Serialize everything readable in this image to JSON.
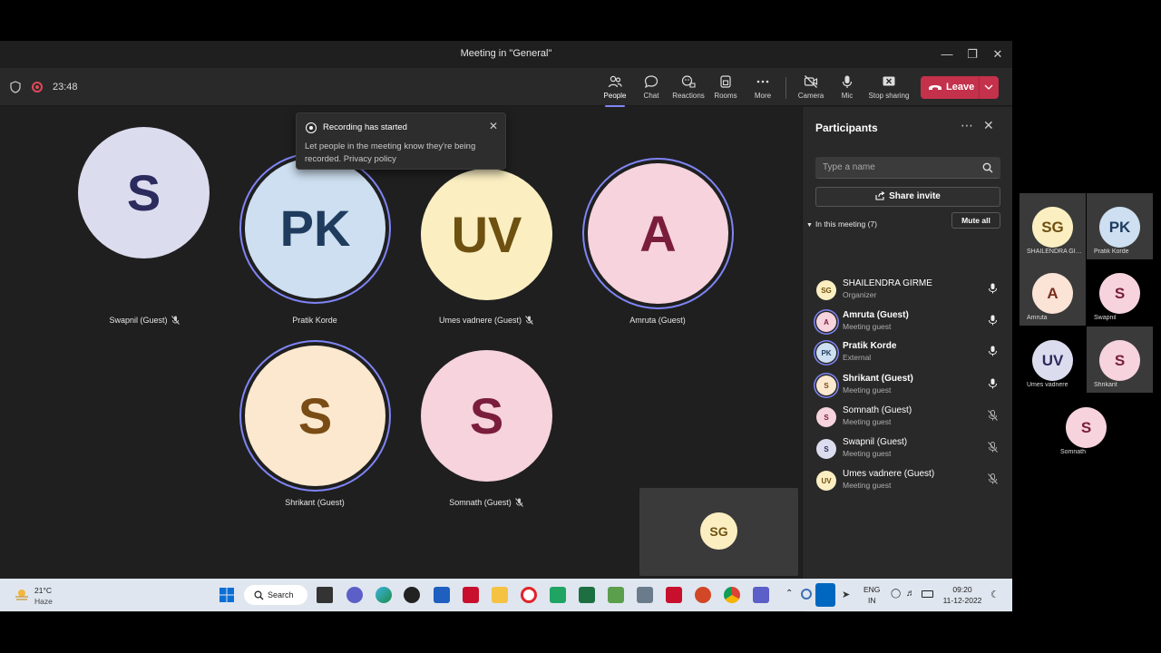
{
  "window": {
    "title": "Meeting in \"General\""
  },
  "toolbar": {
    "timer": "23:48",
    "people": "People",
    "chat": "Chat",
    "reactions": "Reactions",
    "rooms": "Rooms",
    "more": "More",
    "camera": "Camera",
    "mic": "Mic",
    "stop_sharing": "Stop sharing",
    "leave": "Leave"
  },
  "toast": {
    "title": "Recording has started",
    "body": "Let people in the meeting know they're being recorded. Privacy policy"
  },
  "stage": {
    "tiles": [
      {
        "initials": "S",
        "name": "Swapnil (Guest)",
        "muted": true,
        "bg": "#dcdcef",
        "fg": "#2b2b5e"
      },
      {
        "initials": "PK",
        "name": "Pratik Korde",
        "muted": false,
        "bg": "#cddff0",
        "fg": "#1f3c5e"
      },
      {
        "initials": "UV",
        "name": "Umes vadnere (Guest)",
        "muted": true,
        "bg": "#fbefc2",
        "fg": "#6e5110"
      },
      {
        "initials": "A",
        "name": "Amruta (Guest)",
        "muted": false,
        "bg": "#f6d3dd",
        "fg": "#7a1d3d"
      },
      {
        "initials": "S",
        "name": "Shrikant (Guest)",
        "muted": false,
        "bg": "#fbe8cf",
        "fg": "#7a4c15"
      },
      {
        "initials": "S",
        "name": "Somnath (Guest)",
        "muted": true,
        "bg": "#f6d3dd",
        "fg": "#7a1d3d"
      }
    ],
    "self": {
      "initials": "SG"
    }
  },
  "panel": {
    "title": "Participants",
    "search_placeholder": "Type a name",
    "share_invite": "Share invite",
    "section": "In this meeting (7)",
    "mute_all": "Mute all",
    "people": [
      {
        "initials": "SG",
        "name": "SHAILENDRA GIRME",
        "role": "Organizer",
        "bold": false,
        "ring": false,
        "muted": false,
        "bg": "#fbefc2",
        "fg": "#6e5110"
      },
      {
        "initials": "A",
        "name": "Amruta (Guest)",
        "role": "Meeting guest",
        "bold": true,
        "ring": true,
        "muted": false,
        "bg": "#f6d3dd",
        "fg": "#7a1d3d"
      },
      {
        "initials": "PK",
        "name": "Pratik Korde",
        "role": "External",
        "bold": true,
        "ring": true,
        "muted": false,
        "bg": "#cddff0",
        "fg": "#1f3c5e"
      },
      {
        "initials": "S",
        "name": "Shrikant (Guest)",
        "role": "Meeting guest",
        "bold": true,
        "ring": true,
        "muted": false,
        "bg": "#fbe8cf",
        "fg": "#7a4c15"
      },
      {
        "initials": "S",
        "name": "Somnath (Guest)",
        "role": "Meeting guest",
        "bold": false,
        "ring": false,
        "muted": true,
        "bg": "#f6d3dd",
        "fg": "#7a1d3d"
      },
      {
        "initials": "S",
        "name": "Swapnil (Guest)",
        "role": "Meeting guest",
        "bold": false,
        "ring": false,
        "muted": true,
        "bg": "#dcdcef",
        "fg": "#2b2b5e"
      },
      {
        "initials": "UV",
        "name": "Umes vadnere (Guest)",
        "role": "Meeting guest",
        "bold": false,
        "ring": false,
        "muted": true,
        "bg": "#fbefc2",
        "fg": "#6e5110"
      }
    ]
  },
  "taskbar": {
    "temperature": "21°C",
    "condition": "Haze",
    "search": "Search",
    "lang1": "ENG",
    "lang2": "IN",
    "time": "09:20",
    "date": "11-12-2022"
  },
  "side_strip": [
    {
      "initials": "SG",
      "label": "SHAILENDRA GIR...",
      "bg": "#fbefc2",
      "fg": "#6e5110",
      "highlight": true
    },
    {
      "initials": "PK",
      "label": "Pratik Korde",
      "bg": "#cddff0",
      "fg": "#1f3c5e",
      "highlight": true
    },
    {
      "initials": "A",
      "label": "Amruta",
      "bg": "#fbe3d6",
      "fg": "#7a2d1d",
      "highlight": true
    },
    {
      "initials": "S",
      "label": "Swapnil",
      "bg": "#f6d3dd",
      "fg": "#7a1d3d",
      "highlight": false
    },
    {
      "initials": "UV",
      "label": "Umes vadnere",
      "bg": "#dcdcef",
      "fg": "#2b2b5e",
      "highlight": false
    },
    {
      "initials": "S",
      "label": "Shrikant",
      "bg": "#f6d3dd",
      "fg": "#7a1d3d",
      "highlight": true
    },
    {
      "initials": "S",
      "label": "Somnath",
      "bg": "#f6d3dd",
      "fg": "#7a1d3d",
      "highlight": false
    }
  ]
}
